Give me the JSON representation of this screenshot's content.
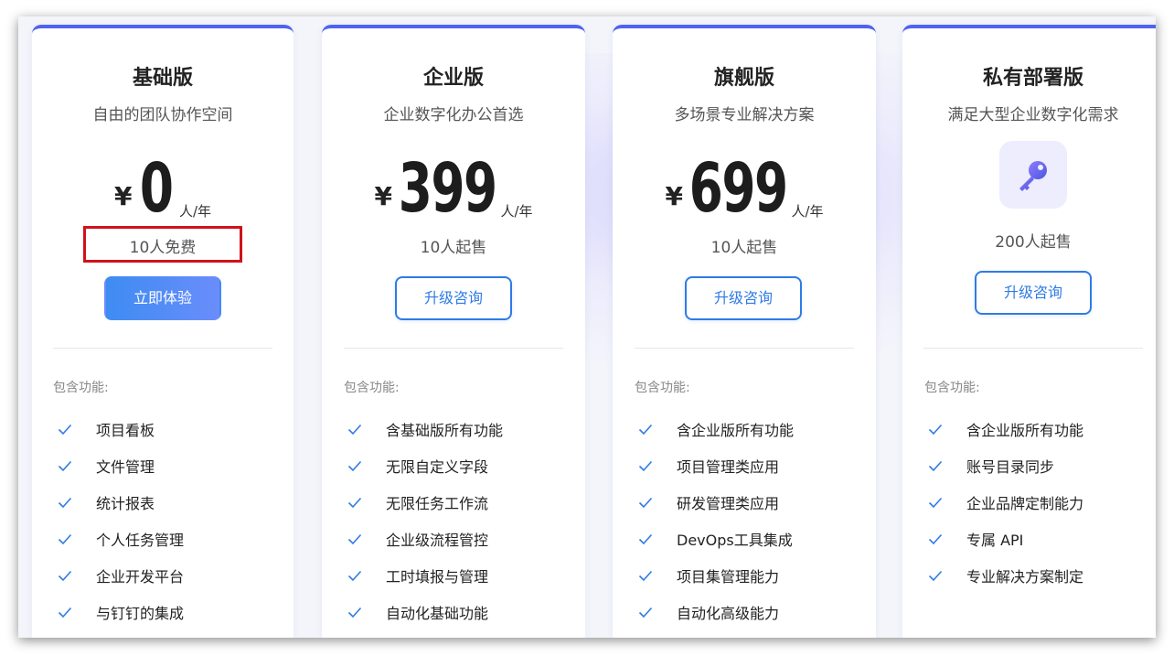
{
  "plans": [
    {
      "name": "基础版",
      "tagline": "自由的团队协作空间",
      "currency": "¥",
      "price": "0",
      "unit": "人/年",
      "seats": "10人免费",
      "button": "立即体验",
      "features_label": "包含功能:",
      "features": [
        "项目看板",
        "文件管理",
        "统计报表",
        "个人任务管理",
        "企业开发平台",
        "与钉钉的集成"
      ]
    },
    {
      "name": "企业版",
      "tagline": "企业数字化办公首选",
      "currency": "¥",
      "price": "399",
      "unit": "人/年",
      "seats": "10人起售",
      "button": "升级咨询",
      "features_label": "包含功能:",
      "features": [
        "含基础版所有功能",
        "无限自定义字段",
        "无限任务工作流",
        "企业级流程管控",
        "工时填报与管理",
        "自动化基础功能"
      ]
    },
    {
      "name": "旗舰版",
      "tagline": "多场景专业解决方案",
      "currency": "¥",
      "price": "699",
      "unit": "人/年",
      "seats": "10人起售",
      "button": "升级咨询",
      "features_label": "包含功能:",
      "features": [
        "含企业版所有功能",
        "项目管理类应用",
        "研发管理类应用",
        "DevOps工具集成",
        "项目集管理能力",
        "自动化高级能力"
      ]
    },
    {
      "name": "私有部署版",
      "tagline": "满足大型企业数字化需求",
      "icon": "key-icon",
      "seats": "200人起售",
      "button": "升级咨询",
      "features_label": "包含功能:",
      "features": [
        "含企业版所有功能",
        "账号目录同步",
        "企业品牌定制能力",
        "专属 API",
        "专业解决方案制定"
      ]
    }
  ],
  "colors": {
    "accent": "#4f63ee",
    "button_blue": "#2f7be5",
    "check": "#2f7be5",
    "highlight_box": "#d0121b"
  }
}
